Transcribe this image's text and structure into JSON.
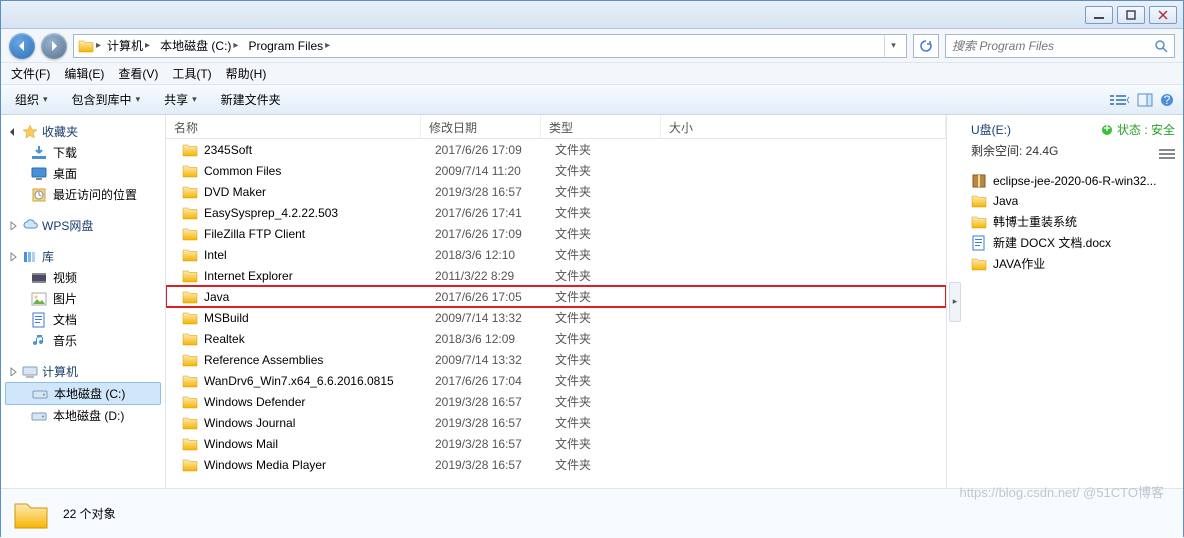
{
  "window": {
    "min": "_",
    "max": "▢",
    "close": "✕"
  },
  "breadcrumbs": [
    "计算机",
    "本地磁盘 (C:)",
    "Program Files"
  ],
  "search": {
    "placeholder": "搜索 Program Files"
  },
  "menu": [
    "文件(F)",
    "编辑(E)",
    "查看(V)",
    "工具(T)",
    "帮助(H)"
  ],
  "toolbar": {
    "org": "组织",
    "lib": "包含到库中",
    "share": "共享",
    "newf": "新建文件夹"
  },
  "columns": {
    "name": "名称",
    "date": "修改日期",
    "type": "类型",
    "size": "大小"
  },
  "sidebar": {
    "fav": "收藏夹",
    "downloads": "下载",
    "desktop": "桌面",
    "recent": "最近访问的位置",
    "wps": "WPS网盘",
    "lib": "库",
    "video": "视频",
    "pictures": "图片",
    "docs": "文档",
    "music": "音乐",
    "computer": "计算机",
    "cdrive": "本地磁盘 (C:)",
    "ddrive": "本地磁盘 (D:)"
  },
  "files": [
    {
      "n": "2345Soft",
      "d": "2017/6/26 17:09",
      "t": "文件夹"
    },
    {
      "n": "Common Files",
      "d": "2009/7/14 11:20",
      "t": "文件夹"
    },
    {
      "n": "DVD Maker",
      "d": "2019/3/28 16:57",
      "t": "文件夹"
    },
    {
      "n": "EasySysprep_4.2.22.503",
      "d": "2017/6/26 17:41",
      "t": "文件夹"
    },
    {
      "n": "FileZilla FTP Client",
      "d": "2017/6/26 17:09",
      "t": "文件夹"
    },
    {
      "n": "Intel",
      "d": "2018/3/6 12:10",
      "t": "文件夹"
    },
    {
      "n": "Internet Explorer",
      "d": "2011/3/22 8:29",
      "t": "文件夹"
    },
    {
      "n": "Java",
      "d": "2017/6/26 17:05",
      "t": "文件夹",
      "hl": true
    },
    {
      "n": "MSBuild",
      "d": "2009/7/14 13:32",
      "t": "文件夹"
    },
    {
      "n": "Realtek",
      "d": "2018/3/6 12:09",
      "t": "文件夹"
    },
    {
      "n": "Reference Assemblies",
      "d": "2009/7/14 13:32",
      "t": "文件夹"
    },
    {
      "n": "WanDrv6_Win7.x64_6.6.2016.0815",
      "d": "2017/6/26 17:04",
      "t": "文件夹"
    },
    {
      "n": "Windows Defender",
      "d": "2019/3/28 16:57",
      "t": "文件夹"
    },
    {
      "n": "Windows Journal",
      "d": "2019/3/28 16:57",
      "t": "文件夹"
    },
    {
      "n": "Windows Mail",
      "d": "2019/3/28 16:57",
      "t": "文件夹"
    },
    {
      "n": "Windows Media Player",
      "d": "2019/3/28 16:57",
      "t": "文件夹"
    }
  ],
  "preview": {
    "title": "U盘(E:)",
    "status": "状态 : 安全",
    "free": "剩余空间: 24.4G",
    "items": [
      {
        "n": "eclipse-jee-2020-06-R-win32...",
        "k": "zip"
      },
      {
        "n": "Java",
        "k": "folder"
      },
      {
        "n": "韩博士重装系统",
        "k": "folder"
      },
      {
        "n": "新建 DOCX 文档.docx",
        "k": "doc"
      },
      {
        "n": "JAVA作业",
        "k": "folder"
      }
    ]
  },
  "status": {
    "count": "22 个对象"
  },
  "watermark": "https://blog.csdn.net/   @51CTO博客"
}
